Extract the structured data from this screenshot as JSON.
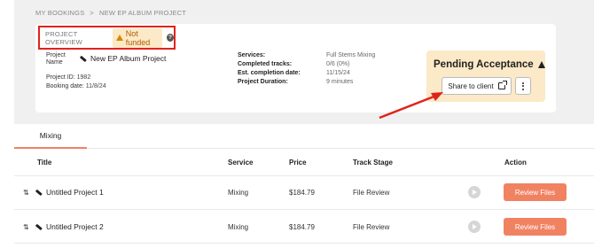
{
  "breadcrumb": {
    "item1": "MY BOOKINGS",
    "sep": ">",
    "item2": "NEW EP ALBUM PROJECT"
  },
  "overview": {
    "label": "PROJECT OVERVIEW",
    "status_badge": "Not funded",
    "help_icon": "?",
    "project_name_label_line1": "Project",
    "project_name_label_line2": "Name",
    "project_name": "New EP Album Project",
    "project_id_label": "Project ID:",
    "project_id": "1982",
    "booking_date_label": "Booking date:",
    "booking_date": "11/8/24"
  },
  "services": {
    "services_label": "Services:",
    "services_value": "Full Stems Mixing",
    "completed_label": "Completed tracks:",
    "completed_value": "0/6 (0%)",
    "est_label": "Est. completion date:",
    "est_value": "11/15/24",
    "duration_label": "Project Duration:",
    "duration_value": "9 minutes"
  },
  "pending": {
    "title": "Pending Acceptance",
    "share_label": "Share to client"
  },
  "tabs": {
    "mixing": "Mixing"
  },
  "table": {
    "headers": {
      "title": "Title",
      "service": "Service",
      "price": "Price",
      "stage": "Track Stage",
      "action": "Action"
    },
    "rows": [
      {
        "title": "Untitled Project 1",
        "service": "Mixing",
        "price": "$184.79",
        "stage": "File Review",
        "action": "Review Files"
      },
      {
        "title": "Untitled Project 2",
        "service": "Mixing",
        "price": "$184.79",
        "stage": "File Review",
        "action": "Review Files"
      }
    ]
  },
  "colors": {
    "accent": "#f08262",
    "highlight_red": "#e0231c",
    "pending_bg": "#fbe9c7",
    "warn_bg": "#fbe9c7"
  },
  "icons": {
    "sort": "sort-arrows-icon",
    "pencil": "pencil-icon",
    "play": "play-icon",
    "share": "share-external-icon",
    "more": "more-vertical-icon",
    "warning": "warning-icon",
    "help": "help-icon"
  }
}
